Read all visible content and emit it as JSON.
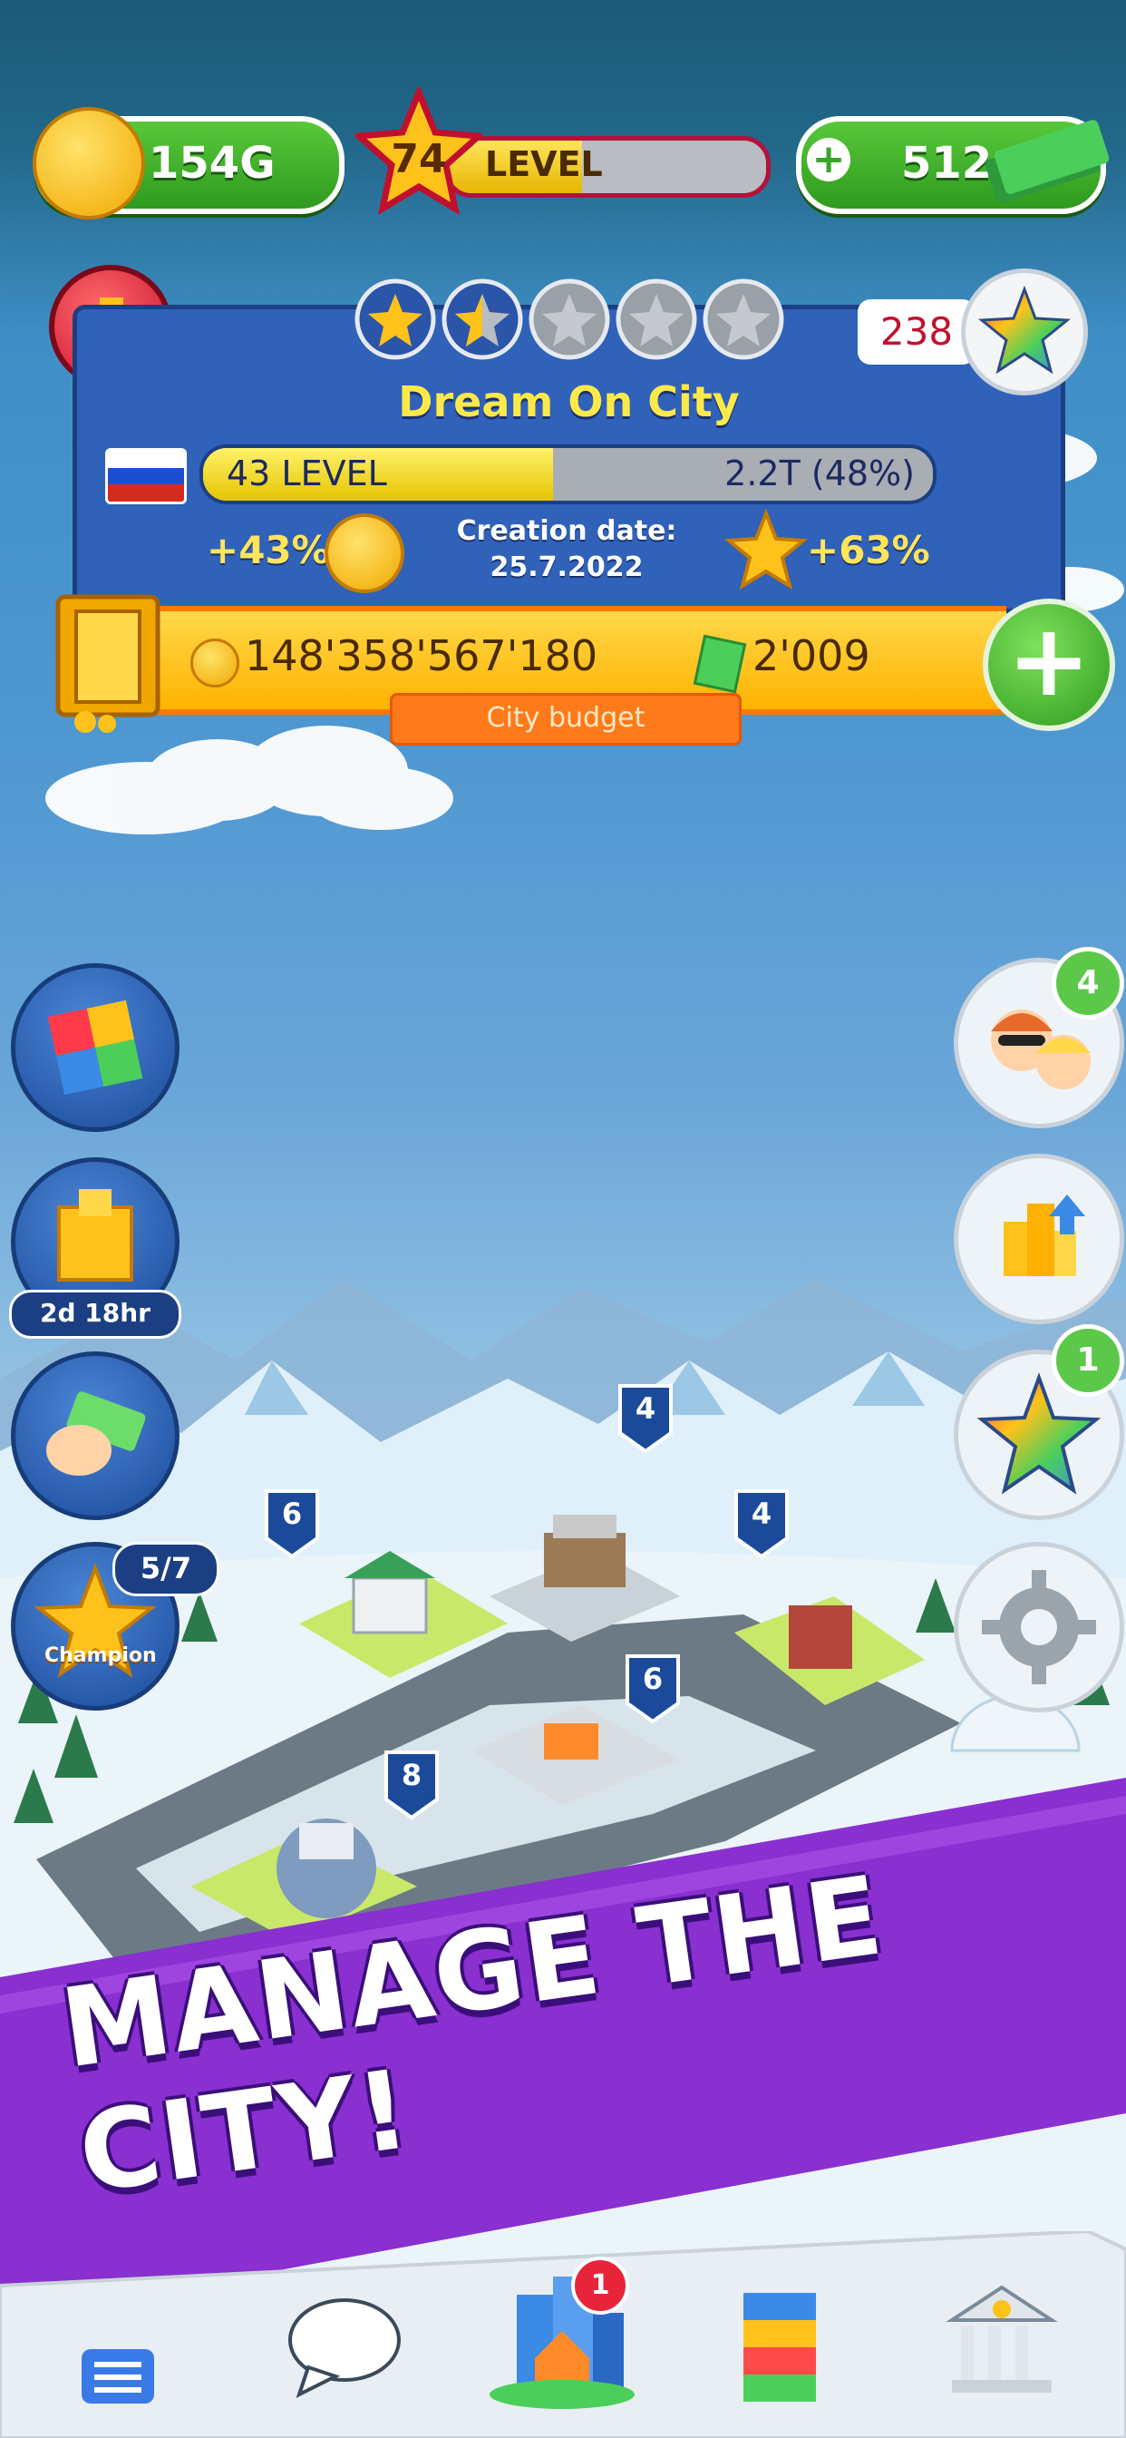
{
  "top_bar": {
    "coins": "154G",
    "level_number": "74",
    "level_label": "LEVEL",
    "level_progress": 0.42,
    "cash": "512"
  },
  "city": {
    "name": "Dream On City",
    "stars_filled": 1.5,
    "stars_total": 5,
    "star_count": "238",
    "level_text": "43 LEVEL",
    "level_progress": 0.48,
    "xp_text": "2.2T (48%)",
    "coin_bonus": "+43%",
    "star_bonus": "+63%",
    "creation_label": "Creation date:",
    "creation_date": "25.7.2022"
  },
  "budget": {
    "coins": "148'358'567'180",
    "cash": "2'009",
    "label": "City budget"
  },
  "left_buttons": {
    "event_timer": "2d 18hr",
    "champion_progress": "5/7",
    "champion_label": "Champion"
  },
  "right_buttons": {
    "friends_badge": "4",
    "stars_badge": "1"
  },
  "map_markers": [
    "4",
    "6",
    "4",
    "6",
    "8"
  ],
  "banner": "MANAGE THE CITY!",
  "nav": {
    "city_badge": "1"
  },
  "colors": {
    "accent_green": "#3aa52a",
    "panel_blue": "#2f62b8",
    "banner_purple": "#8a2fd0",
    "gold": "#ffc21a"
  }
}
